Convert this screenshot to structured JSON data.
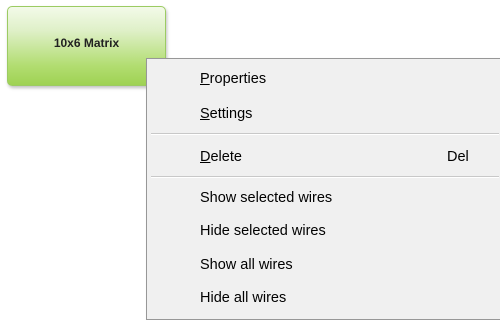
{
  "node": {
    "title": "10x6 Matrix"
  },
  "context_menu": {
    "properties": {
      "accel": "P",
      "rest": "roperties"
    },
    "settings": {
      "accel": "S",
      "rest": "ettings"
    },
    "delete": {
      "accel": "D",
      "rest": "elete",
      "shortcut": "Del"
    },
    "show_selected_wires": "Show selected wires",
    "hide_selected_wires": "Hide selected wires",
    "show_all_wires": "Show all wires",
    "hide_all_wires": "Hide all wires"
  }
}
